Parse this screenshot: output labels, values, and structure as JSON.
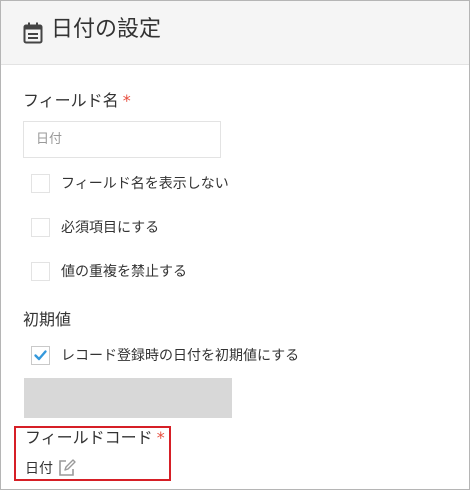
{
  "header": {
    "title": "日付の設定",
    "icon": "calendar-icon"
  },
  "field_name": {
    "label": "フィールド名",
    "required_mark": "*",
    "placeholder": "日付"
  },
  "options": [
    {
      "label": "フィールド名を表示しない",
      "checked": false
    },
    {
      "label": "必須項目にする",
      "checked": false
    },
    {
      "label": "値の重複を禁止する",
      "checked": false
    }
  ],
  "initial_value": {
    "label": "初期値",
    "checkbox_label": "レコード登録時の日付を初期値にする",
    "checked": true
  },
  "field_code": {
    "label": "フィールドコード",
    "required_mark": "*",
    "value": "日付",
    "edit_icon": "pencil-edit-icon"
  },
  "colors": {
    "required": "#e74c3c",
    "checkmark": "#3498db",
    "highlight_border": "#d61f26"
  }
}
